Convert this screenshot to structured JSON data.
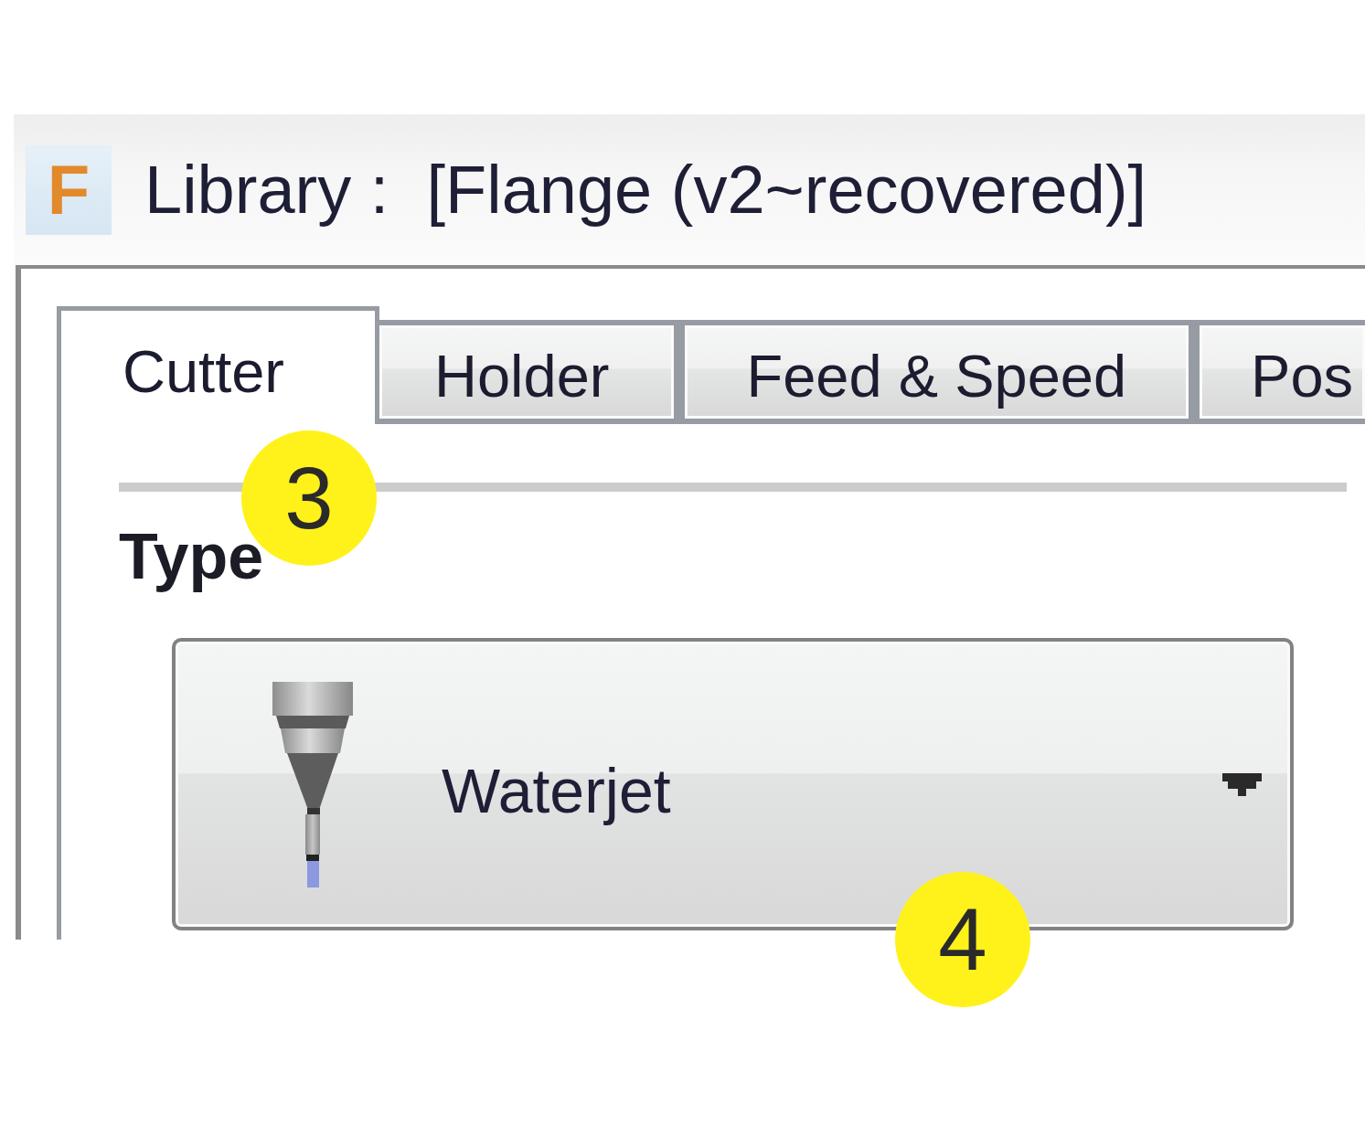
{
  "window": {
    "logo_text": "F",
    "title": "Library :  [Flange (v2~recovered)]"
  },
  "tabs": [
    {
      "label": "Cutter",
      "selected": true
    },
    {
      "label": "Holder",
      "selected": false
    },
    {
      "label": "Feed & Speed",
      "selected": false
    },
    {
      "label": "Pos",
      "selected": false
    }
  ],
  "cutter_panel": {
    "section_heading": "Type",
    "type_dropdown": {
      "value": "Waterjet"
    }
  },
  "callouts": [
    {
      "number": "3"
    },
    {
      "number": "4"
    }
  ]
}
